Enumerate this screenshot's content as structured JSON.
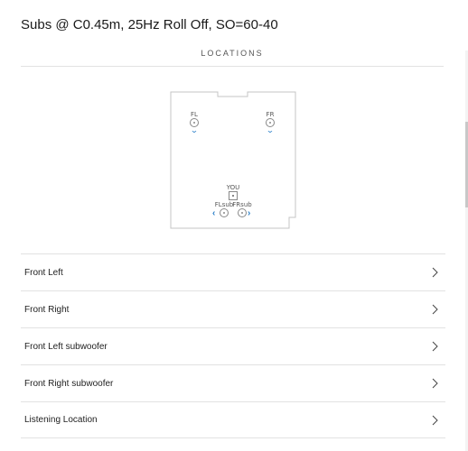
{
  "header": {
    "title": "Subs @ C0.45m, 25Hz Roll Off, SO=60-40"
  },
  "section": {
    "label": "LOCATIONS"
  },
  "room_map": {
    "speakers": {
      "fl": "FL",
      "fr": "FR",
      "you": "YOU",
      "flsub": "FLsub",
      "frsub": "FRsub"
    }
  },
  "locations": [
    {
      "label": "Front Left"
    },
    {
      "label": "Front Right"
    },
    {
      "label": "Front Left subwoofer"
    },
    {
      "label": "Front Right subwoofer"
    },
    {
      "label": "Listening Location"
    }
  ],
  "colors": {
    "accent": "#2a7fc9",
    "outline": "#888888",
    "divider": "#e2e2e2"
  },
  "icons": {
    "row_chevron": "chevron-right-icon",
    "speaker_direction": "chevron-down-icon",
    "sub_arrows": "arrow-left-icon"
  }
}
